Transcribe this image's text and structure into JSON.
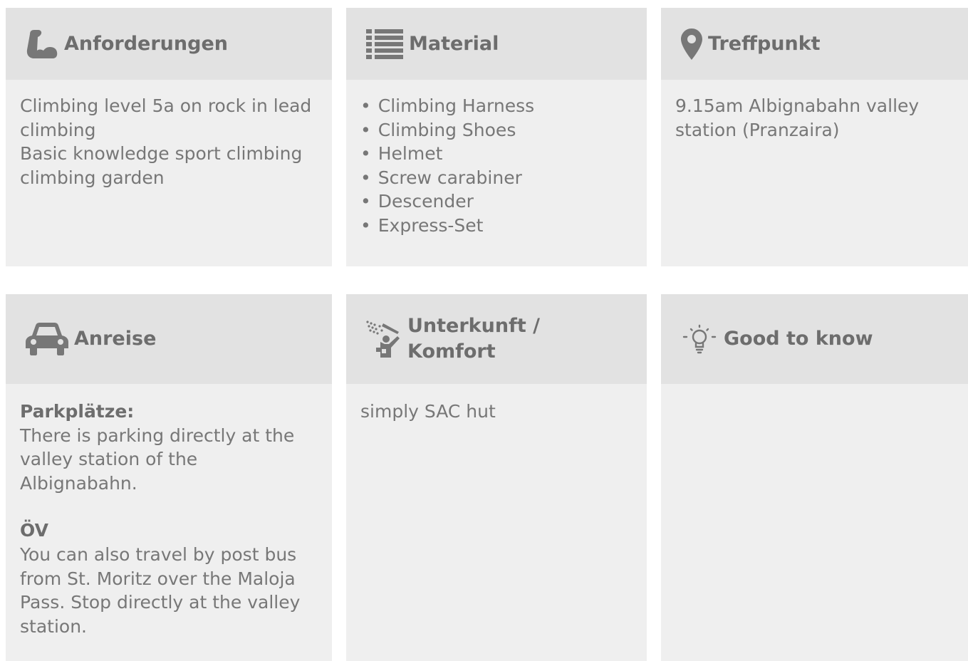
{
  "cards": {
    "requirements": {
      "title": "Anforderungen",
      "lines": [
        "Climbing level 5a on rock in lead climbing",
        "Basic knowledge sport climbing climbing garden"
      ]
    },
    "material": {
      "title": "Material",
      "items": [
        "Climbing Harness",
        "Climbing Shoes",
        "Helmet",
        "Screw carabiner",
        "Descender",
        "Express-Set"
      ]
    },
    "meeting_point": {
      "title": "Treffpunkt",
      "text": "9.15am Albignabahn valley station (Pranzaira)"
    },
    "arrival": {
      "title": "Anreise",
      "parking_label": "Parkplätze:",
      "parking_text": "There is parking directly at the valley station of the Albignabahn.",
      "transit_label": "ÖV",
      "transit_text": "You can also travel by post bus from St. Moritz over the Maloja Pass. Stop directly at the valley station."
    },
    "accommodation": {
      "title": "Unterkunft / Komfort",
      "text": "simply SAC hut"
    },
    "good_to_know": {
      "title": "Good to know"
    }
  },
  "icons": {
    "requirements": "flexed-arm-icon",
    "material": "list-icon",
    "meeting_point": "map-pin-icon",
    "arrival": "car-icon",
    "accommodation": "shower-icon",
    "good_to_know": "lightbulb-icon"
  },
  "colors": {
    "header_bg": "#e2e2e2",
    "card_bg": "#efefef",
    "text": "#777777",
    "icon": "#777777"
  }
}
